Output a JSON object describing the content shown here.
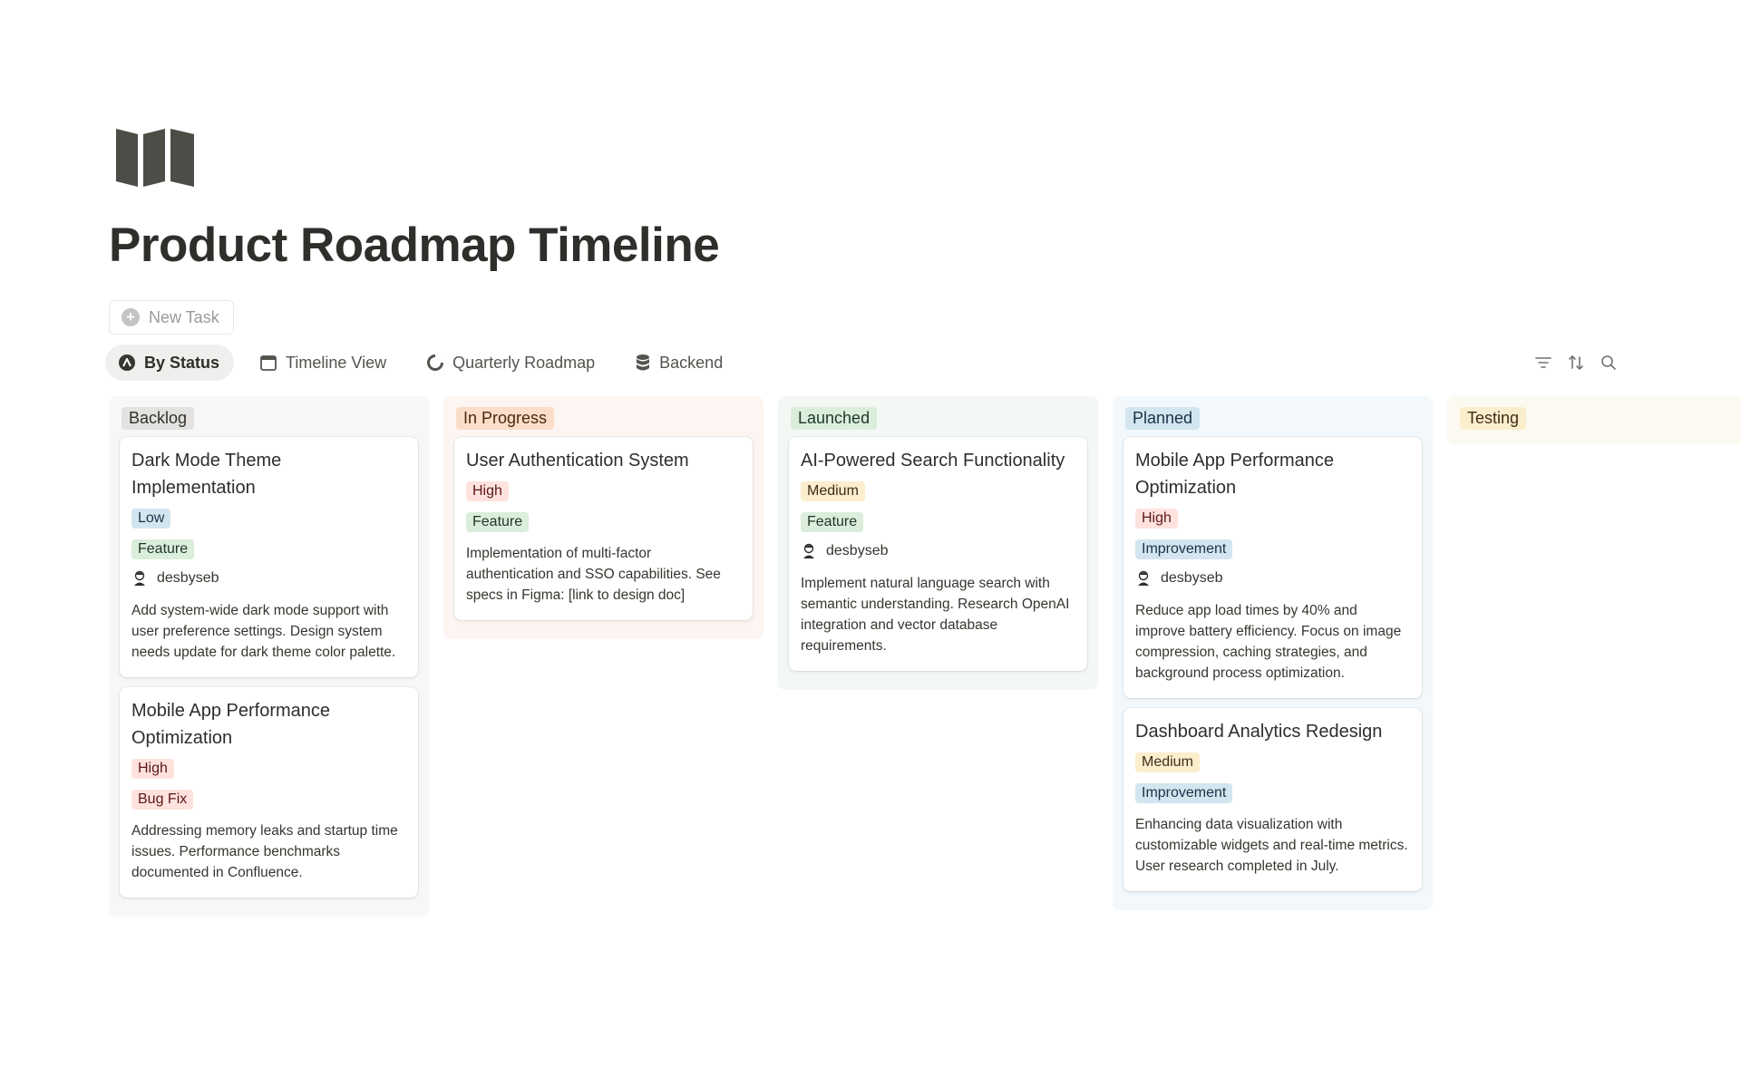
{
  "page": {
    "title": "Product Roadmap Timeline",
    "icon": "map-icon"
  },
  "new_task": {
    "label": "New Task",
    "icon": "plus-circle-icon"
  },
  "views": [
    {
      "label": "By Status",
      "icon": "status-icon",
      "active": true
    },
    {
      "label": "Timeline View",
      "icon": "calendar-icon",
      "active": false
    },
    {
      "label": "Quarterly Roadmap",
      "icon": "pie-chart-icon",
      "active": false
    },
    {
      "label": "Backend",
      "icon": "database-icon",
      "active": false
    }
  ],
  "toolbar": {
    "icons": [
      "filter-icon",
      "sort-icon",
      "search-icon"
    ]
  },
  "columns": [
    {
      "label": "Backlog",
      "bg": "#f7f7f5",
      "label_bg": "#e3e2e0",
      "label_color": "#32302c",
      "cards": [
        {
          "title": "Dark Mode Theme Implementation",
          "priority": "Low",
          "type": "Feature",
          "assignee": "desbyseb",
          "description": "Add system-wide dark mode support with user preference settings. Design system needs update for dark theme color palette."
        },
        {
          "title": "Mobile App Performance Optimization",
          "priority": "High",
          "type": "Bug Fix",
          "assignee": "",
          "description": "Addressing memory leaks and startup time issues. Performance benchmarks documented in Confluence."
        }
      ]
    },
    {
      "label": "In Progress",
      "bg": "#fcf5f2",
      "label_bg": "#fadec9",
      "label_color": "#49290e",
      "cards": [
        {
          "title": "User Authentication System",
          "priority": "High",
          "type": "Feature",
          "assignee": "",
          "description": "Implementation of multi-factor authentication and SSO capabilities. See specs in Figma: [link to design doc]"
        }
      ]
    },
    {
      "label": "Launched",
      "bg": "#f4f8f5",
      "label_bg": "#dbeddb",
      "label_color": "#1c3829",
      "cards": [
        {
          "title": "AI-Powered Search Functionality",
          "priority": "Medium",
          "type": "Feature",
          "assignee": "desbyseb",
          "description": "Implement natural language search with semantic understanding. Research OpenAI integration and vector database requirements."
        }
      ]
    },
    {
      "label": "Planned",
      "bg": "#f2f8fb",
      "label_bg": "#d3e5ef",
      "label_color": "#183347",
      "cards": [
        {
          "title": "Mobile App Performance Optimization",
          "priority": "High",
          "type": "Improvement",
          "assignee": "desbyseb",
          "description": "Reduce app load times by 40% and improve battery efficiency. Focus on image compression, caching strategies, and background process optimization."
        },
        {
          "title": "Dashboard Analytics Redesign",
          "priority": "Medium",
          "type": "Improvement",
          "assignee": "",
          "description": "Enhancing data visualization with customizable widgets and real-time metrics. User research completed in July."
        }
      ]
    },
    {
      "label": "Testing",
      "bg": "#fcf9f0",
      "label_bg": "#fbeecc",
      "label_color": "#402c1b",
      "cards": []
    }
  ]
}
